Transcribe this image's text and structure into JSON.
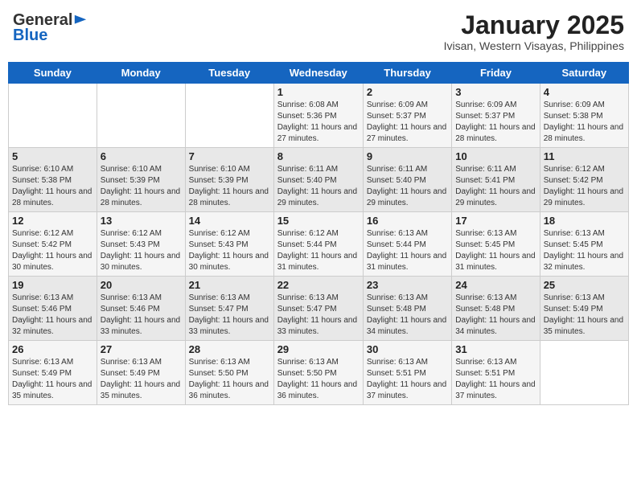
{
  "logo": {
    "general": "General",
    "blue": "Blue"
  },
  "title": "January 2025",
  "subtitle": "Ivisan, Western Visayas, Philippines",
  "days_of_week": [
    "Sunday",
    "Monday",
    "Tuesday",
    "Wednesday",
    "Thursday",
    "Friday",
    "Saturday"
  ],
  "weeks": [
    [
      {
        "day": "",
        "detail": ""
      },
      {
        "day": "",
        "detail": ""
      },
      {
        "day": "",
        "detail": ""
      },
      {
        "day": "1",
        "detail": "Sunrise: 6:08 AM\nSunset: 5:36 PM\nDaylight: 11 hours and 27 minutes."
      },
      {
        "day": "2",
        "detail": "Sunrise: 6:09 AM\nSunset: 5:37 PM\nDaylight: 11 hours and 27 minutes."
      },
      {
        "day": "3",
        "detail": "Sunrise: 6:09 AM\nSunset: 5:37 PM\nDaylight: 11 hours and 28 minutes."
      },
      {
        "day": "4",
        "detail": "Sunrise: 6:09 AM\nSunset: 5:38 PM\nDaylight: 11 hours and 28 minutes."
      }
    ],
    [
      {
        "day": "5",
        "detail": "Sunrise: 6:10 AM\nSunset: 5:38 PM\nDaylight: 11 hours and 28 minutes."
      },
      {
        "day": "6",
        "detail": "Sunrise: 6:10 AM\nSunset: 5:39 PM\nDaylight: 11 hours and 28 minutes."
      },
      {
        "day": "7",
        "detail": "Sunrise: 6:10 AM\nSunset: 5:39 PM\nDaylight: 11 hours and 28 minutes."
      },
      {
        "day": "8",
        "detail": "Sunrise: 6:11 AM\nSunset: 5:40 PM\nDaylight: 11 hours and 29 minutes."
      },
      {
        "day": "9",
        "detail": "Sunrise: 6:11 AM\nSunset: 5:40 PM\nDaylight: 11 hours and 29 minutes."
      },
      {
        "day": "10",
        "detail": "Sunrise: 6:11 AM\nSunset: 5:41 PM\nDaylight: 11 hours and 29 minutes."
      },
      {
        "day": "11",
        "detail": "Sunrise: 6:12 AM\nSunset: 5:42 PM\nDaylight: 11 hours and 29 minutes."
      }
    ],
    [
      {
        "day": "12",
        "detail": "Sunrise: 6:12 AM\nSunset: 5:42 PM\nDaylight: 11 hours and 30 minutes."
      },
      {
        "day": "13",
        "detail": "Sunrise: 6:12 AM\nSunset: 5:43 PM\nDaylight: 11 hours and 30 minutes."
      },
      {
        "day": "14",
        "detail": "Sunrise: 6:12 AM\nSunset: 5:43 PM\nDaylight: 11 hours and 30 minutes."
      },
      {
        "day": "15",
        "detail": "Sunrise: 6:12 AM\nSunset: 5:44 PM\nDaylight: 11 hours and 31 minutes."
      },
      {
        "day": "16",
        "detail": "Sunrise: 6:13 AM\nSunset: 5:44 PM\nDaylight: 11 hours and 31 minutes."
      },
      {
        "day": "17",
        "detail": "Sunrise: 6:13 AM\nSunset: 5:45 PM\nDaylight: 11 hours and 31 minutes."
      },
      {
        "day": "18",
        "detail": "Sunrise: 6:13 AM\nSunset: 5:45 PM\nDaylight: 11 hours and 32 minutes."
      }
    ],
    [
      {
        "day": "19",
        "detail": "Sunrise: 6:13 AM\nSunset: 5:46 PM\nDaylight: 11 hours and 32 minutes."
      },
      {
        "day": "20",
        "detail": "Sunrise: 6:13 AM\nSunset: 5:46 PM\nDaylight: 11 hours and 33 minutes."
      },
      {
        "day": "21",
        "detail": "Sunrise: 6:13 AM\nSunset: 5:47 PM\nDaylight: 11 hours and 33 minutes."
      },
      {
        "day": "22",
        "detail": "Sunrise: 6:13 AM\nSunset: 5:47 PM\nDaylight: 11 hours and 33 minutes."
      },
      {
        "day": "23",
        "detail": "Sunrise: 6:13 AM\nSunset: 5:48 PM\nDaylight: 11 hours and 34 minutes."
      },
      {
        "day": "24",
        "detail": "Sunrise: 6:13 AM\nSunset: 5:48 PM\nDaylight: 11 hours and 34 minutes."
      },
      {
        "day": "25",
        "detail": "Sunrise: 6:13 AM\nSunset: 5:49 PM\nDaylight: 11 hours and 35 minutes."
      }
    ],
    [
      {
        "day": "26",
        "detail": "Sunrise: 6:13 AM\nSunset: 5:49 PM\nDaylight: 11 hours and 35 minutes."
      },
      {
        "day": "27",
        "detail": "Sunrise: 6:13 AM\nSunset: 5:49 PM\nDaylight: 11 hours and 35 minutes."
      },
      {
        "day": "28",
        "detail": "Sunrise: 6:13 AM\nSunset: 5:50 PM\nDaylight: 11 hours and 36 minutes."
      },
      {
        "day": "29",
        "detail": "Sunrise: 6:13 AM\nSunset: 5:50 PM\nDaylight: 11 hours and 36 minutes."
      },
      {
        "day": "30",
        "detail": "Sunrise: 6:13 AM\nSunset: 5:51 PM\nDaylight: 11 hours and 37 minutes."
      },
      {
        "day": "31",
        "detail": "Sunrise: 6:13 AM\nSunset: 5:51 PM\nDaylight: 11 hours and 37 minutes."
      },
      {
        "day": "",
        "detail": ""
      }
    ]
  ]
}
